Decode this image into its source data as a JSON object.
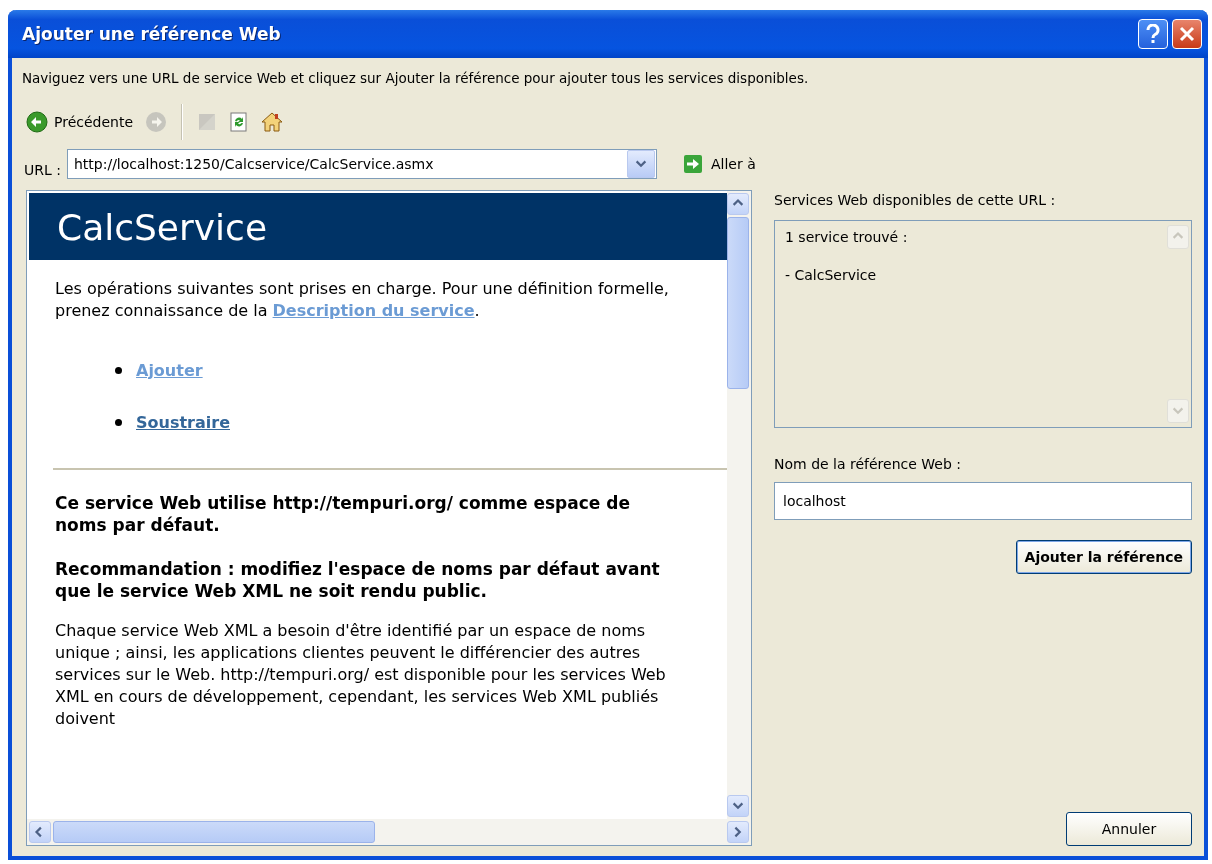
{
  "window": {
    "title": "Ajouter une référence Web"
  },
  "instructions": "Naviguez vers une URL de service Web et cliquez sur Ajouter la référence pour ajouter tous les services disponibles.",
  "toolbar": [
    {
      "kind": "back",
      "label": "Précédente",
      "disabled": false
    },
    {
      "kind": "forward",
      "disabled": true
    },
    {
      "kind": "separator"
    },
    {
      "kind": "stop",
      "disabled": true
    },
    {
      "kind": "refresh",
      "disabled": false
    },
    {
      "kind": "home",
      "disabled": false
    }
  ],
  "url": {
    "label": "URL :",
    "value": "http://localhost:1250/Calcservice/CalcService.asmx",
    "go_label": "Aller à"
  },
  "browser": {
    "page_title": "CalcService",
    "intro": "Les opérations suivantes sont prises en charge. Pour une définition formelle, prenez connaissance de la ",
    "intro_link": {
      "label": "Description du service",
      "visited": true
    },
    "intro_end": ".",
    "operations": [
      {
        "label": "Ajouter",
        "visited": true
      },
      {
        "label": "Soustraire",
        "visited": false
      }
    ],
    "headings": [
      "Ce service Web utilise http://tempuri.org/ comme espace de noms par défaut.",
      "Recommandation : modifiez l'espace de noms par défaut avant que le service Web XML ne soit rendu public."
    ],
    "body": "Chaque service Web XML a besoin d'être identifié par un espace de noms unique ; ainsi, les applications clientes peuvent le différencier des autres services sur le Web. http://tempuri.org/ est disponible pour les services Web XML en cours de développement, cependant, les services Web XML publiés doivent"
  },
  "services": {
    "label": "Services Web disponibles de cette URL :",
    "lines": [
      "1 service trouvé :",
      "- CalcService"
    ]
  },
  "reference": {
    "label": "Nom de la référence Web :",
    "value": "localhost"
  },
  "add_button": "Ajouter la référence",
  "cancel_button": "Annuler"
}
